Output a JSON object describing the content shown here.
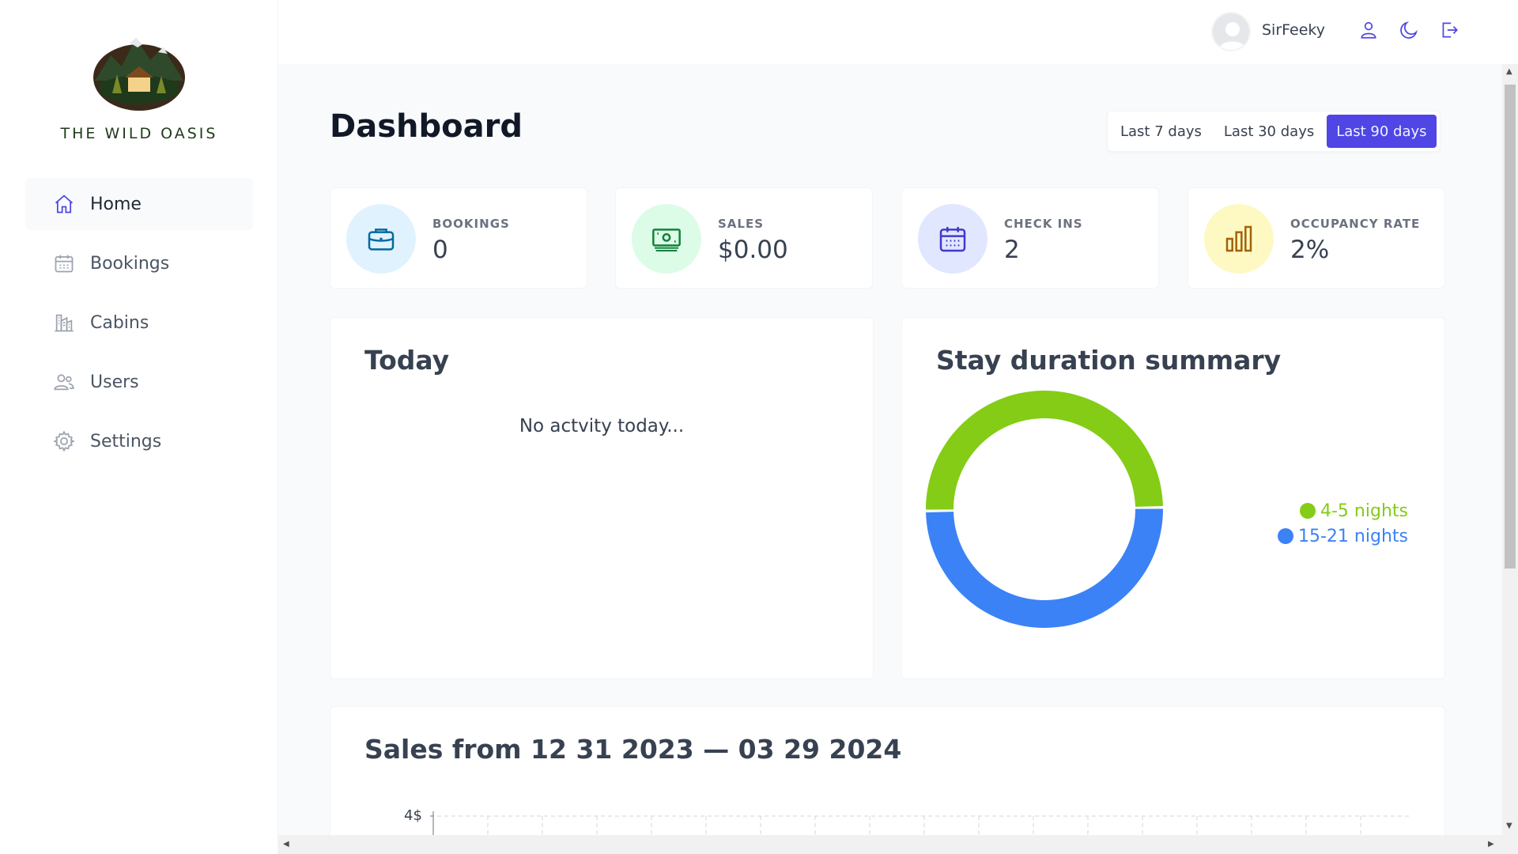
{
  "brand": {
    "name": "THE WILD OASIS"
  },
  "sidebar": {
    "items": [
      {
        "label": "Home",
        "icon": "home-icon",
        "active": true
      },
      {
        "label": "Bookings",
        "icon": "calendar-icon",
        "active": false
      },
      {
        "label": "Cabins",
        "icon": "cabins-icon",
        "active": false
      },
      {
        "label": "Users",
        "icon": "users-icon",
        "active": false
      },
      {
        "label": "Settings",
        "icon": "gear-icon",
        "active": false
      }
    ]
  },
  "header": {
    "username": "SirFeeky",
    "icons": [
      "user-icon",
      "moon-icon",
      "logout-icon"
    ]
  },
  "dashboard": {
    "title": "Dashboard",
    "filters": [
      "Last 7 days",
      "Last 30 days",
      "Last 90 days"
    ],
    "active_filter": "Last 90 days",
    "stats": [
      {
        "label": "BOOKINGS",
        "value": "0",
        "icon": "briefcase-icon",
        "color": "#0369a1",
        "bg": "#e0f2fe"
      },
      {
        "label": "SALES",
        "value": "$0.00",
        "icon": "banknotes-icon",
        "color": "#15803d",
        "bg": "#dcfce7"
      },
      {
        "label": "CHECK INS",
        "value": "2",
        "icon": "calendar-days-icon",
        "color": "#4338ca",
        "bg": "#e0e7ff"
      },
      {
        "label": "OCCUPANCY RATE",
        "value": "2%",
        "icon": "chart-bar-icon",
        "color": "#a16207",
        "bg": "#fef9c3"
      }
    ],
    "today": {
      "title": "Today",
      "empty_message": "No actvity today..."
    },
    "duration": {
      "title": "Stay duration summary"
    },
    "sales": {
      "title": "Sales from 12 31 2023 — 03 29 2024",
      "y_tick": "4$"
    }
  },
  "chart_data": {
    "type": "pie",
    "categories": [
      "4-5 nights",
      "15-21 nights"
    ],
    "values": [
      1,
      1
    ],
    "colors": [
      "#84cc16",
      "#3b82f6"
    ],
    "legend": "right"
  },
  "colors": {
    "accent": "#4f46e5",
    "background": "#f9fafb"
  }
}
